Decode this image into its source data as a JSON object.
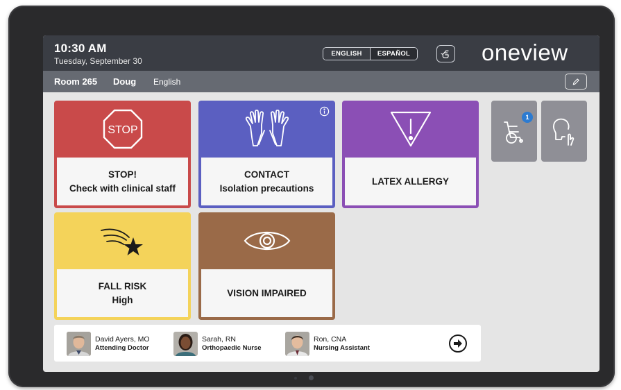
{
  "header": {
    "time": "10:30 AM",
    "date": "Tuesday, September 30",
    "languages": [
      "ENGLISH",
      "ESPAÑOL"
    ],
    "call_icon": "hand-bell-icon",
    "logo": "oneview"
  },
  "patient_bar": {
    "room": "Room 265",
    "name": "Doug",
    "language": "English",
    "edit_icon": "pencil-icon"
  },
  "alerts": [
    {
      "id": "stop",
      "line1": "STOP!",
      "line2": "Check with clinical staff",
      "color": "#c94a4a",
      "icon": "stop-sign-icon",
      "icon_text": "STOP"
    },
    {
      "id": "contact",
      "line1": "CONTACT",
      "line2": "Isolation precautions",
      "color": "#5b5fc1",
      "icon": "gloves-icon",
      "info_icon": "info-icon"
    },
    {
      "id": "latex",
      "line1": "LATEX ALLERGY",
      "line2": "",
      "color": "#8b4fb5",
      "icon": "warning-triangle-icon"
    },
    {
      "id": "fall",
      "line1": "FALL RISK",
      "line2": "High",
      "color": "#f4d35a",
      "icon": "falling-star-icon"
    },
    {
      "id": "vision",
      "line1": "VISION IMPAIRED",
      "line2": "",
      "color": "#9a6a48",
      "icon": "eye-icon"
    }
  ],
  "side_tiles": [
    {
      "id": "mobility",
      "icon": "wheelchair-icon",
      "badge": "1"
    },
    {
      "id": "communication",
      "icon": "sign-language-icon"
    }
  ],
  "care_team": [
    {
      "name": "David Ayers, MO",
      "role": "Attending Doctor"
    },
    {
      "name": "Sarah, RN",
      "role": "Orthopaedic Nurse"
    },
    {
      "name": "Ron, CNA",
      "role": "Nursing Assistant"
    }
  ],
  "care_team_next_icon": "arrow-right-circle-icon",
  "colors": {
    "header_bg": "#3a3d44",
    "infobar_bg": "#666a72",
    "screen_bg": "#e5e5e5",
    "tile_gray": "#8f8f96",
    "badge_blue": "#2c7bd1"
  }
}
